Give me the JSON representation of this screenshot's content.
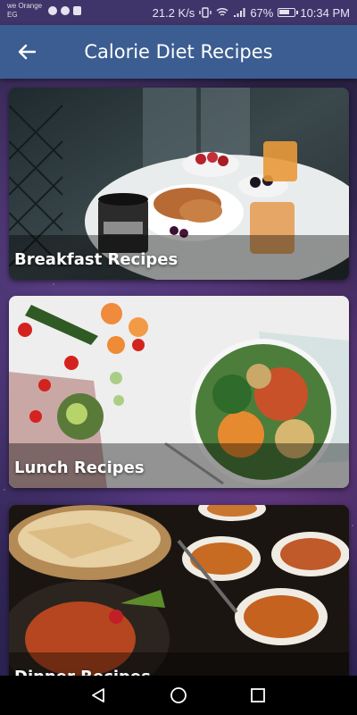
{
  "status_bar": {
    "carrier": "we Orange EG",
    "speed": "21.2 K/s",
    "battery": "67%",
    "time": "10:34 PM"
  },
  "app_bar": {
    "title": "Calorie Diet Recipes",
    "back_icon": "arrow-back-icon"
  },
  "categories": [
    {
      "label": "Breakfast Recipes"
    },
    {
      "label": "Lunch Recipes"
    },
    {
      "label": "Dinner Recipes"
    }
  ],
  "nav_bar": {
    "back_icon": "triangle-back-icon",
    "home_icon": "circle-home-icon",
    "recents_icon": "square-recents-icon"
  }
}
